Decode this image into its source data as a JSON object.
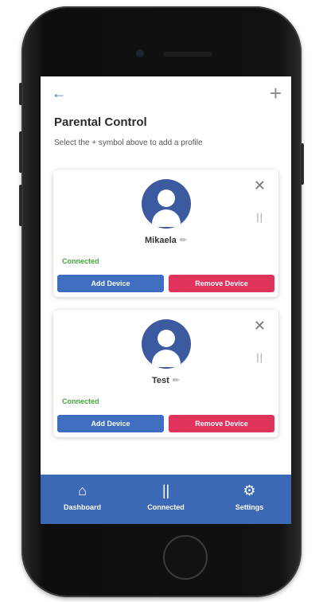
{
  "header": {
    "back_icon": "arrow-left-icon",
    "add_icon": "plus-icon",
    "title": "Parental Control",
    "subtitle": "Select the + symbol above to add a profile"
  },
  "profiles": [
    {
      "name": "Mikaela",
      "status": "Connected",
      "add_label": "Add Device",
      "remove_label": "Remove Device"
    },
    {
      "name": "Test",
      "status": "Connected",
      "add_label": "Add Device",
      "remove_label": "Remove Device"
    }
  ],
  "tabbar": {
    "items": [
      {
        "label": "Dashboard",
        "icon": "home-icon"
      },
      {
        "label": "Connected",
        "icon": "pause-icon"
      },
      {
        "label": "Settings",
        "icon": "gear-icon"
      }
    ]
  },
  "colors": {
    "primary": "#3b69b6",
    "danger": "#e0325a",
    "success": "#44a53c",
    "avatar": "#3b5aa0"
  }
}
